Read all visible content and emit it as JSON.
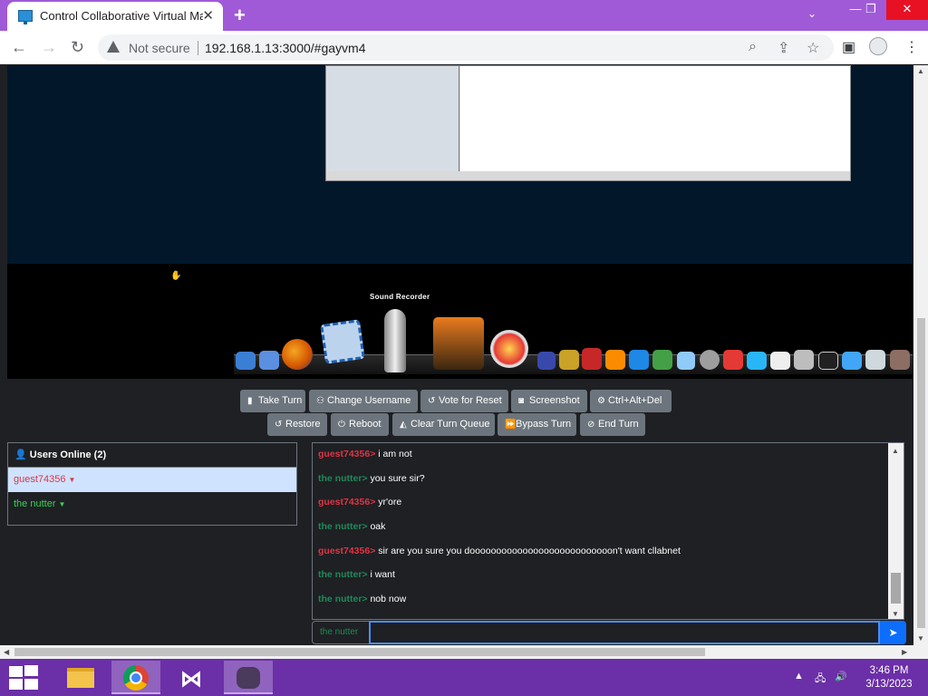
{
  "browser": {
    "tab_title": "Control Collaborative Virtual Ma",
    "tab_close": "✕",
    "new_tab": "+",
    "security_label": "Not secure",
    "url": "192.168.1.13:3000/#gayvm4"
  },
  "vm": {
    "dock_label": "Sound Recorder"
  },
  "controls": {
    "take_turn": "Take Turn",
    "change_username": "Change Username",
    "vote_reset": "Vote for Reset",
    "screenshot": "Screenshot",
    "ctrl_alt_del": "Ctrl+Alt+Del",
    "restore": "Restore",
    "reboot": "Reboot",
    "clear_queue": "Clear Turn Queue",
    "bypass_turn": "Bypass Turn",
    "end_turn": "End Turn"
  },
  "users": {
    "header": "Users Online (2)",
    "list": [
      {
        "name": "guest74356",
        "color": "#dc3545"
      },
      {
        "name": "the nutter",
        "color": "#39d353"
      }
    ]
  },
  "chat": {
    "messages": [
      {
        "user": "guest74356>",
        "text": "i am not",
        "color": "#dc3545"
      },
      {
        "user": "the nutter>",
        "text": "you sure sir?",
        "color": "#1e8a5a"
      },
      {
        "user": "guest74356>",
        "text": "yr'ore",
        "color": "#dc3545"
      },
      {
        "user": "the nutter>",
        "text": "oak",
        "color": "#1e8a5a"
      },
      {
        "user": "guest74356>",
        "text": "sir are you sure you dooooooooooooooooooooooooooon't want cllabnet",
        "color": "#dc3545"
      },
      {
        "user": "the nutter>",
        "text": "i want",
        "color": "#1e8a5a"
      },
      {
        "user": "the nutter>",
        "text": "nob now",
        "color": "#1e8a5a"
      }
    ],
    "username_label": "the nutter",
    "input_value": ""
  },
  "taskbar": {
    "time": "3:46 PM",
    "date": "3/13/2023"
  },
  "colors": {
    "chrome_frame": "#a05ad7",
    "taskbar": "#6b2fa8",
    "button_secondary": "#6c757d",
    "send_primary": "#0d6efd"
  }
}
